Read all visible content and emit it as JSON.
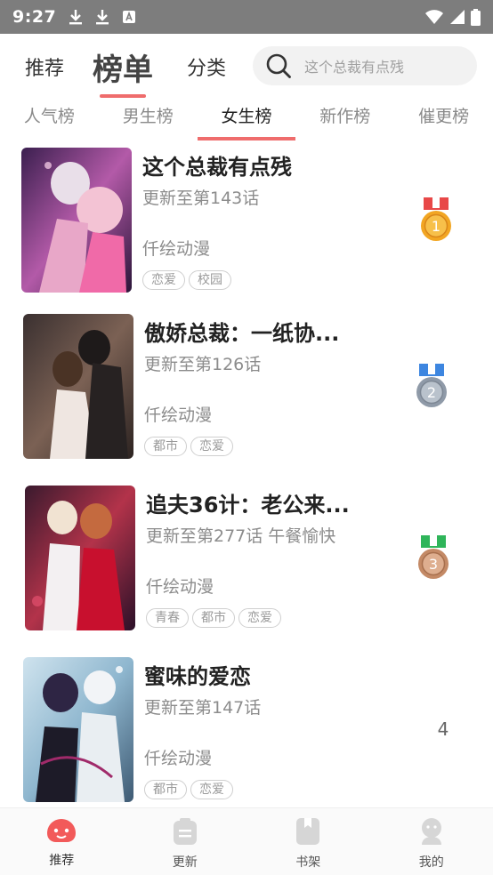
{
  "status_bar": {
    "time": "9:27"
  },
  "top_nav": {
    "tabs": [
      {
        "label": "推荐"
      },
      {
        "label": "榜单"
      },
      {
        "label": "分类"
      }
    ],
    "search_placeholder": "这个总裁有点残",
    "accent_color": "#ef6c6c"
  },
  "sub_tabs": [
    {
      "label": "人气榜"
    },
    {
      "label": "男生榜"
    },
    {
      "label": "女生榜"
    },
    {
      "label": "新作榜"
    },
    {
      "label": "催更榜"
    }
  ],
  "comics": [
    {
      "title": "这个总裁有点残",
      "update": "更新至第143话",
      "author": "仟绘动漫",
      "tags": [
        "恋爱",
        "校园"
      ],
      "rank": "1",
      "rank_icon": "gold-medal-icon"
    },
    {
      "title": "傲娇总裁：一纸协...",
      "update": "更新至第126话",
      "author": "仟绘动漫",
      "tags": [
        "都市",
        "恋爱"
      ],
      "rank": "2",
      "rank_icon": "silver-medal-icon"
    },
    {
      "title": "追夫36计：老公来...",
      "update": "更新至第277话 午餐愉快",
      "author": "仟绘动漫",
      "tags": [
        "青春",
        "都市",
        "恋爱"
      ],
      "rank": "3",
      "rank_icon": "bronze-medal-icon"
    },
    {
      "title": "蜜味的爱恋",
      "update": "更新至第147话",
      "author": "仟绘动漫",
      "tags": [
        "都市",
        "恋爱"
      ],
      "rank": "4",
      "rank_icon": ""
    }
  ],
  "bottom_nav": [
    {
      "label": "推荐",
      "icon": "recommend-icon"
    },
    {
      "label": "更新",
      "icon": "update-icon"
    },
    {
      "label": "书架",
      "icon": "bookshelf-icon"
    },
    {
      "label": "我的",
      "icon": "profile-icon"
    }
  ]
}
